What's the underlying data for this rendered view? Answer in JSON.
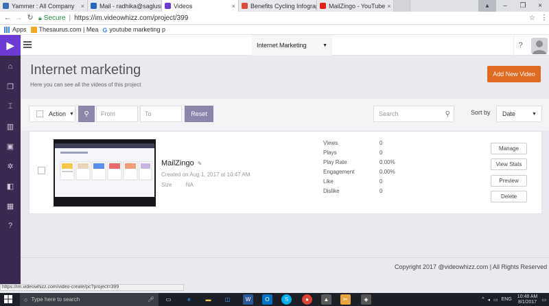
{
  "browser": {
    "tabs": [
      {
        "label": "Yammer : All Company",
        "color": "#3b6fb6",
        "glyph": "Y"
      },
      {
        "label": "Mail - radhika@saglusin",
        "color": "#2b64c7",
        "glyph": "O"
      },
      {
        "label": "Videos",
        "color": "#6c3bd6",
        "glyph": "▶"
      },
      {
        "label": "Benefits Cycling Infograp",
        "color": "#e0493c",
        "glyph": "B"
      },
      {
        "label": "MailZingo - YouTube",
        "color": "#e62117",
        "glyph": "▶"
      }
    ],
    "secure_label": "Secure",
    "url": "https://im.videowhizz.com/project/399",
    "bookmarks": [
      {
        "label": "Apps",
        "icon": "apps-grid-icon"
      },
      {
        "label": "Thesaurus.com | Mea",
        "icon": "thesaurus-icon"
      },
      {
        "label": "youtube marketing p",
        "icon": "google-g-icon"
      }
    ]
  },
  "header": {
    "logo_glyph": "▶",
    "project_select": "Internet Marketing",
    "help_label": "?"
  },
  "sidebar": {
    "items": [
      {
        "icon": "home-icon",
        "glyph": "⌂"
      },
      {
        "icon": "copy-icon",
        "glyph": "❐"
      },
      {
        "icon": "layout-icon",
        "glyph": "⌶"
      },
      {
        "icon": "chart-icon",
        "glyph": "▥"
      },
      {
        "icon": "video-camera-icon",
        "glyph": "▣"
      },
      {
        "icon": "settings-icon",
        "glyph": "✲"
      },
      {
        "icon": "book-icon",
        "glyph": "◧"
      },
      {
        "icon": "gift-icon",
        "glyph": "▦"
      },
      {
        "icon": "help-icon",
        "glyph": "?"
      }
    ]
  },
  "page": {
    "title": "Internet marketing",
    "subtitle": "Here you can see all the videos of this project",
    "add_button": "Add New Video"
  },
  "toolbar": {
    "action_label": "Action",
    "from_placeholder": "From",
    "to_placeholder": "To",
    "reset_label": "Reset",
    "search_placeholder": "Search",
    "sort_label": "Sort by",
    "sort_value": "Date"
  },
  "video": {
    "title": "MailZingo",
    "created": "Created on Aug 1, 2017 at 10:47 AM",
    "size_label": "Size",
    "size_value": "NA",
    "stats": [
      {
        "label": "Views",
        "value": "0"
      },
      {
        "label": "Plays",
        "value": "0"
      },
      {
        "label": "Play Rate",
        "value": "0.00%"
      },
      {
        "label": "Engagement",
        "value": "0.00%"
      },
      {
        "label": "Like",
        "value": "0"
      },
      {
        "label": "Dislike",
        "value": "0"
      }
    ],
    "actions": [
      "Manage",
      "View Stats",
      "Preview",
      "Delete"
    ]
  },
  "footer": {
    "copyright": "Copyright 2017 @videowhizz.com | All Rights Reserved"
  },
  "status_bar": {
    "url": "https://im.videowhizz.com/video-create/pc?project=399"
  },
  "taskbar": {
    "search_placeholder": "Type here to search",
    "time": "10:48 AM",
    "date": "8/1/2017"
  },
  "colors": {
    "brand": "#6c3bd6",
    "sidebar": "#3b2a4f",
    "accent_orange": "#e26a1f",
    "muted_purple": "#8c86ab"
  }
}
